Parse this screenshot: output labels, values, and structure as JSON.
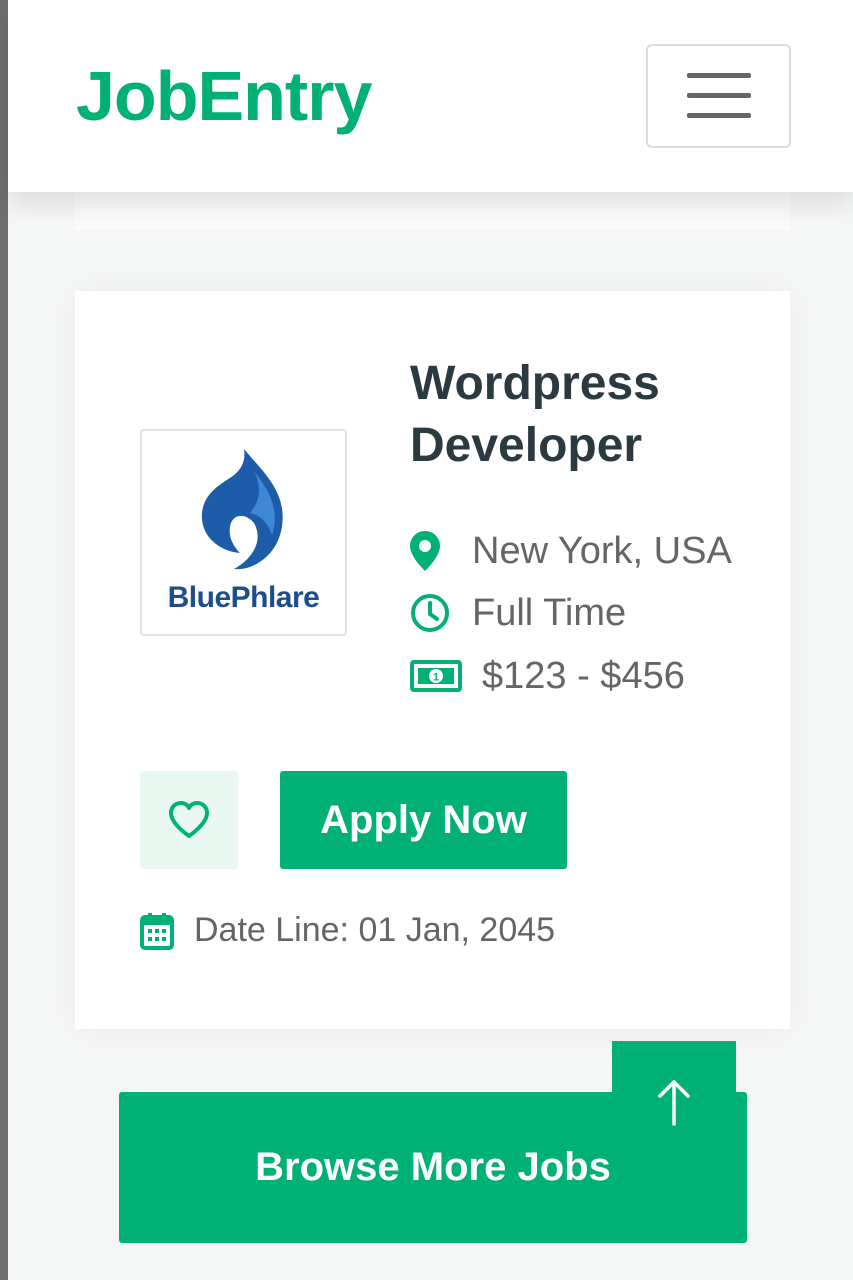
{
  "navbar": {
    "brand": "JobEntry",
    "menu_icon": "hamburger-menu-icon"
  },
  "job": {
    "company_logo_text": "BluePhlare",
    "title": "Wordpress Developer",
    "location": "New York, USA",
    "job_type": "Full Time",
    "salary": "$123 - $456",
    "apply_label": "Apply Now",
    "date_line": "Date Line: 01 Jan, 2045",
    "icons": {
      "location": "map-marker-icon",
      "type": "clock-icon",
      "salary": "money-bill-icon",
      "favorite": "heart-icon",
      "date": "calendar-icon"
    }
  },
  "browse_label": "Browse More Jobs",
  "back_to_top_icon": "arrow-up-icon",
  "colors": {
    "primary": "#00b074",
    "heading": "#2b3940",
    "text": "#666565",
    "light_primary": "#eaf8f2"
  }
}
